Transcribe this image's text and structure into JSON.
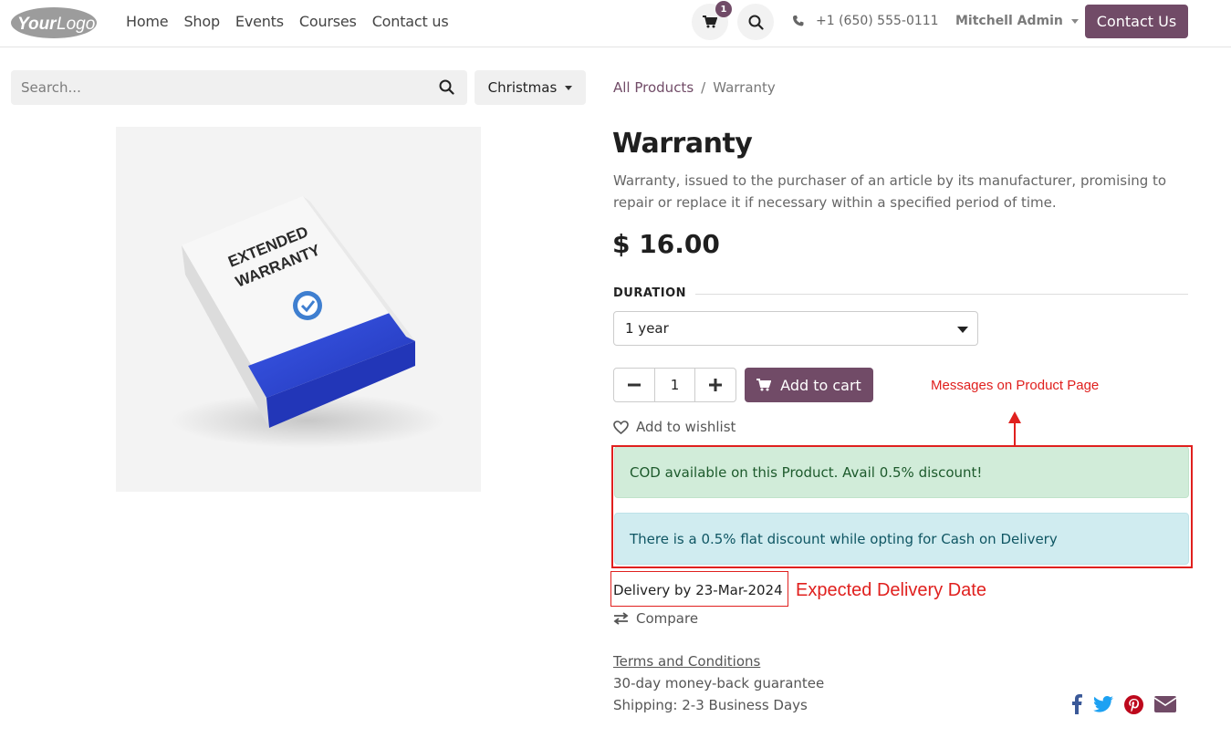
{
  "header": {
    "logo_text": "YourLogo",
    "nav": [
      "Home",
      "Shop",
      "Events",
      "Courses",
      "Contact us"
    ],
    "cart_count": "1",
    "phone": "+1 (650) 555-0111",
    "user": "Mitchell Admin",
    "contact_button": "Contact Us"
  },
  "search": {
    "placeholder": "Search...",
    "filter_label": "Christmas"
  },
  "product": {
    "image_text": [
      "EXTENDED",
      "WARRANTY"
    ],
    "breadcrumb": {
      "parent": "All Products",
      "separator": "/",
      "current": "Warranty"
    },
    "title": "Warranty",
    "description": "Warranty, issued to the purchaser of an article by its manufacturer, promising to repair or replace it if necessary within a specified period of time.",
    "price": "$ 16.00",
    "attribute_label": "DURATION",
    "duration_selected": "1 year",
    "quantity": "1",
    "add_to_cart": "Add to cart",
    "wishlist": "Add to wishlist",
    "messages": {
      "success": "COD available on this Product. Avail 0.5% discount!",
      "info": "There is a 0.5% flat discount while opting for Cash on Delivery"
    },
    "delivery": "Delivery by 23-Mar-2024",
    "compare": "Compare",
    "terms": "Terms and Conditions",
    "guarantee": "30-day money-back guarantee",
    "shipping": "Shipping: 2-3 Business Days"
  },
  "annotations": {
    "messages_label": "Messages on Product Page",
    "delivery_label": "Expected Delivery Date"
  },
  "colors": {
    "brand": "#714b67",
    "annotation": "#e0201e",
    "success_bg": "#d1ecd9",
    "info_bg": "#d0ecf0"
  },
  "icons": [
    "cart-icon",
    "search-icon",
    "phone-icon",
    "heart-icon",
    "compare-icon",
    "facebook-icon",
    "twitter-icon",
    "pinterest-icon",
    "envelope-icon"
  ]
}
